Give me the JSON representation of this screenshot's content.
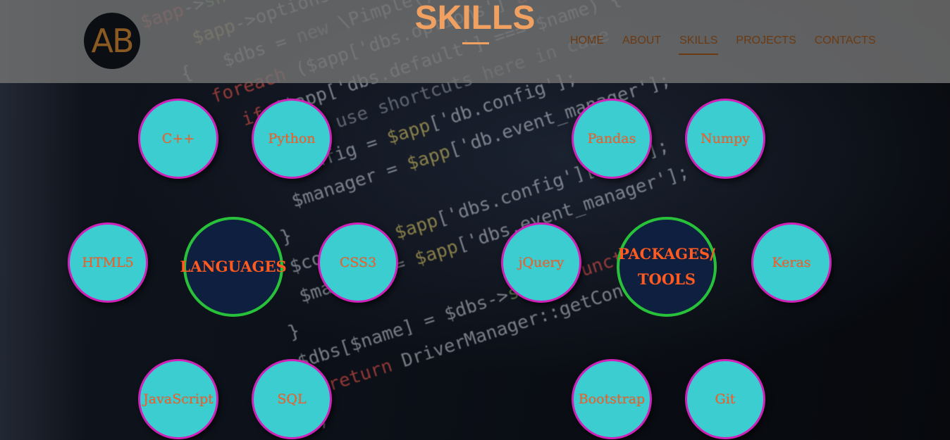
{
  "header": {
    "logo_text": "AB",
    "page_title": "SKILLS",
    "nav": [
      "HOME",
      "ABOUT",
      "SKILLS",
      "PROJECTS",
      "CONTACTS"
    ],
    "active_nav": "SKILLS"
  },
  "colors": {
    "bubble_fill": "#3ccdd0",
    "bubble_border": "#d021b8",
    "bubble_text": "#ff5a1f",
    "hub_fill": "#0e1f3f",
    "hub_border": "#28c23a",
    "title": "#f0a060",
    "nav_text": "#6b3a12"
  },
  "languages": {
    "hub": "LANGUAGES",
    "skills": [
      "C++",
      "Python",
      "HTML5",
      "CSS3",
      "JavaScript",
      "SQL"
    ]
  },
  "packages": {
    "hub": "PACKAGES/\nTOOLS",
    "skills": [
      "Pandas",
      "Numpy",
      "jQuery",
      "Keras",
      "Bootstrap",
      "Git"
    ]
  }
}
